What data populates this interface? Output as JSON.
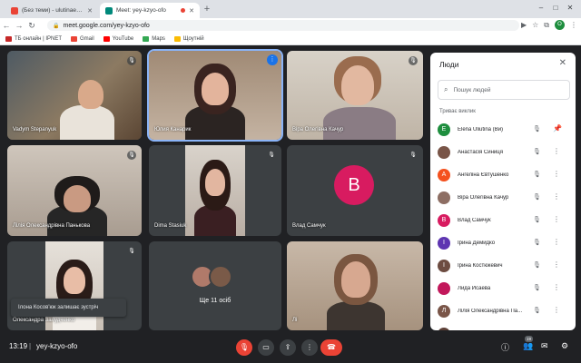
{
  "browser": {
    "tabs": [
      {
        "title": "(Без теми) - ulutinaea@gmail.com"
      },
      {
        "title": "Meet: yey-kzyo-ofo"
      }
    ],
    "new_tab_glyph": "+",
    "window_controls": [
      "–",
      "□",
      "✕"
    ],
    "url": "meet.google.com/yey-kzyo-ofo",
    "profile_initial": "O",
    "bookmarks": [
      {
        "label": "ТБ онлайн | IPNET",
        "color": "#c62828"
      },
      {
        "label": "Gmail",
        "color": "#ea4335"
      },
      {
        "label": "YouTube",
        "color": "#ff0000"
      },
      {
        "label": "Maps",
        "color": "#34a853"
      },
      {
        "label": "Щоутній",
        "color": "#fbbc04"
      }
    ]
  },
  "tiles": [
    {
      "name": "Vadym Stepanyuk"
    },
    {
      "name": "Юлия Канарик"
    },
    {
      "name": "Віра Олегівна Качур"
    },
    {
      "name": "Лілія Олександрівна Панькова"
    },
    {
      "name": "Dima Stasiuk"
    },
    {
      "name": "Влад Самчук",
      "initial": "B"
    },
    {
      "name": "Олександра Залудченко"
    },
    {
      "name": "Ще 11 осіб"
    },
    {
      "name": "Лі"
    }
  ],
  "toast": "Ілона Косов'юк залишає зустріч",
  "people_panel": {
    "title": "Люди",
    "search_placeholder": "Пошук людей",
    "section": "Триває виклик",
    "people": [
      {
        "name": "Elena Uliutina (Ви)",
        "initial": "E",
        "color": "#1e8e3e"
      },
      {
        "name": "Анастасія Синиця",
        "initial": "",
        "color": "#795548"
      },
      {
        "name": "Ангеліна Євтушенко",
        "initial": "A",
        "color": "#f4511e"
      },
      {
        "name": "Віра Олегівна Качур",
        "initial": "",
        "color": "#8d6e63"
      },
      {
        "name": "Влад Самчук",
        "initial": "B",
        "color": "#d81b60"
      },
      {
        "name": "Ірина Демидко",
        "initial": "I",
        "color": "#5e35b1"
      },
      {
        "name": "Ірина Костюкевич",
        "initial": "I",
        "color": "#6d4c41"
      },
      {
        "name": "Лида Исаева",
        "initial": "",
        "color": "#c2185b"
      },
      {
        "name": "Лілія Олександрівна Па...",
        "initial": "Л",
        "color": "#795548"
      },
      {
        "name": "",
        "initial": "",
        "color": "#5d4037"
      }
    ]
  },
  "bottom": {
    "time": "13:19",
    "separator": "|",
    "meeting_code": "yey-kzyo-ofo",
    "participants_count": "19"
  },
  "colors": {
    "meet_bg": "#202124",
    "tile_bg": "#3c4043",
    "accent": "#1a73e8",
    "danger": "#ea4335"
  }
}
